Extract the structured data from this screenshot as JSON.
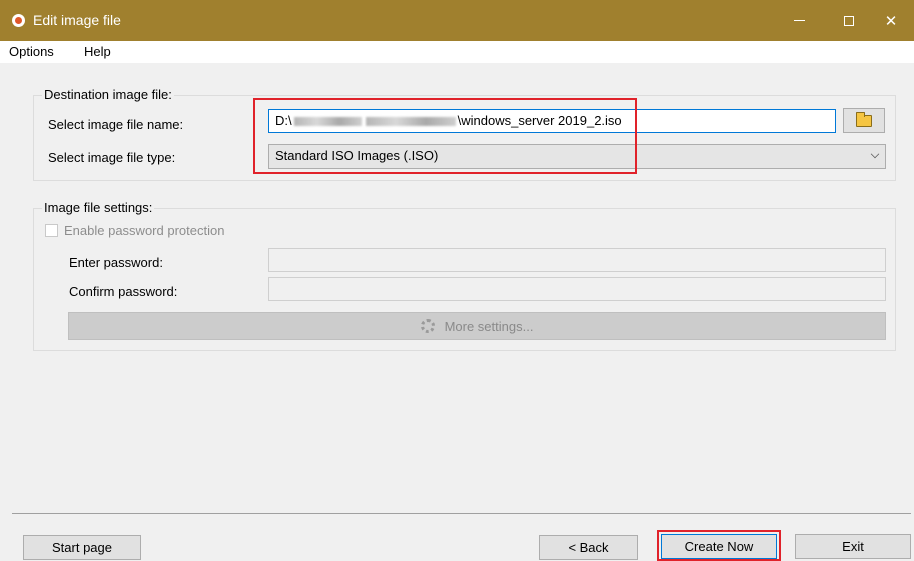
{
  "window": {
    "title": "Edit image file",
    "min_icon": "minimize-icon",
    "max_icon": "maximize-icon",
    "close_glyph": "✕"
  },
  "menu": {
    "options": "Options",
    "help": "Help"
  },
  "destination": {
    "legend": "Destination image file:",
    "name_label": "Select image file name:",
    "path_prefix": "D:\\",
    "path_suffix": "\\windows_server 2019_2.iso",
    "type_label": "Select image file type:",
    "type_value": "Standard ISO Images (.ISO)"
  },
  "settings": {
    "legend": "Image file settings:",
    "enable_password": "Enable password protection",
    "enter_password": "Enter password:",
    "confirm_password": "Confirm password:",
    "more_settings": "More settings..."
  },
  "footer": {
    "start_page": "Start page",
    "back": "<  Back",
    "create_now": "Create Now",
    "exit": "Exit"
  },
  "colors": {
    "titlebar": "#a0802e",
    "highlight": "#e0222a",
    "focus": "#0078d7"
  }
}
